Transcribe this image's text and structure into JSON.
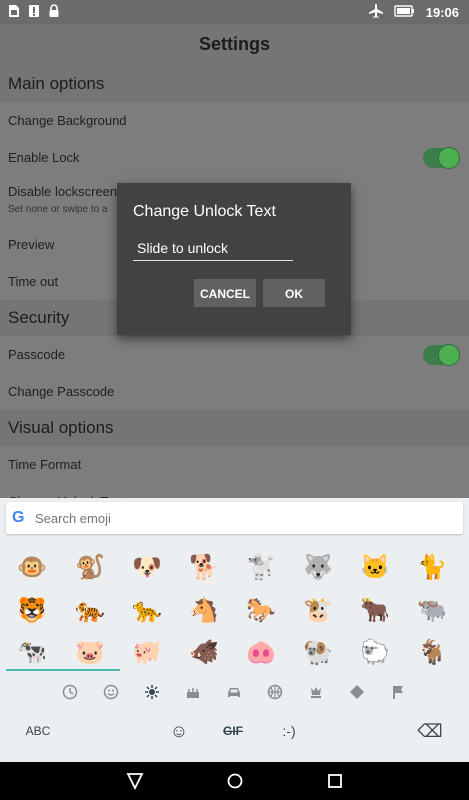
{
  "status_bar": {
    "time": "19:06",
    "left_icons": [
      "sim-card-icon",
      "notification-icon",
      "lock-icon"
    ],
    "right_icons": [
      "airplane-icon",
      "battery-icon"
    ]
  },
  "app": {
    "title": "Settings"
  },
  "settings": {
    "main_options_header": "Main options",
    "change_background": "Change Background",
    "enable_lock": "Enable Lock",
    "disable_lockscreen": "Disable lockscreen",
    "disable_lockscreen_sub": "Set none or swipe to a",
    "preview": "Preview",
    "time_out": "Time out",
    "security_header": "Security",
    "passcode": "Passcode",
    "change_passcode": "Change Passcode",
    "visual_options_header": "Visual options",
    "time_format": "Time Format",
    "change_unlock_text_partial": "Change Unlock Text"
  },
  "dialog": {
    "title": "Change Unlock Text",
    "input_value": "Slide to unlock",
    "cancel_label": "CANCEL",
    "ok_label": "OK"
  },
  "keyboard": {
    "search_placeholder": "Search emoji",
    "google_logo": "G",
    "emoji_rows": [
      [
        "🐵",
        "🐒",
        "🐶",
        "🐕",
        "🐩",
        "🐺",
        "🐱",
        "🐈"
      ],
      [
        "🐯",
        "🐅",
        "🐆",
        "🐴",
        "🐎",
        "🐮",
        "🐂",
        "🐃"
      ],
      [
        "🐄",
        "🐷",
        "🐖",
        "🐗",
        "🐽",
        "🐏",
        "🐑",
        "🐐"
      ]
    ],
    "categories": [
      "recent-icon",
      "smiley-icon",
      "nature-icon",
      "food-icon",
      "travel-icon",
      "activity-icon",
      "objects-icon",
      "symbols-icon",
      "flags-icon"
    ],
    "bottom": {
      "abc_label": "ABC",
      "emoji_key": "☺",
      "gif_label": "GIF",
      "emoticon_label": ":-)",
      "backspace": "⌫"
    }
  },
  "colors": {
    "toggle_on": "#4caf50",
    "accent": "#4db6ac",
    "dialog_bg": "#424242"
  }
}
